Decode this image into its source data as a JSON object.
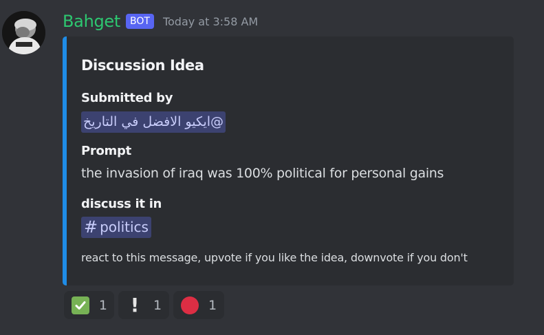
{
  "message": {
    "author": "Bahget",
    "bot_tag": "BOT",
    "timestamp": "Today at 3:58 AM"
  },
  "embed": {
    "accent_color": "#1f8ce6",
    "title": "Discussion Idea",
    "submitted_label": "Submitted by",
    "submitted_mention": "@ايكيو الافضل في التاريخ",
    "prompt_label": "Prompt",
    "prompt_value": "the invasion of iraq was 100% political for personal gains",
    "discuss_label": "discuss it in",
    "channel_name": "politics",
    "footer_note": "react to this message, upvote if you like the idea, downvote if you don't"
  },
  "reactions": [
    {
      "icon": "white-check-mark-icon",
      "count": "1"
    },
    {
      "icon": "exclamation-icon",
      "count": "1"
    },
    {
      "icon": "red-circle-icon",
      "count": "1"
    }
  ]
}
